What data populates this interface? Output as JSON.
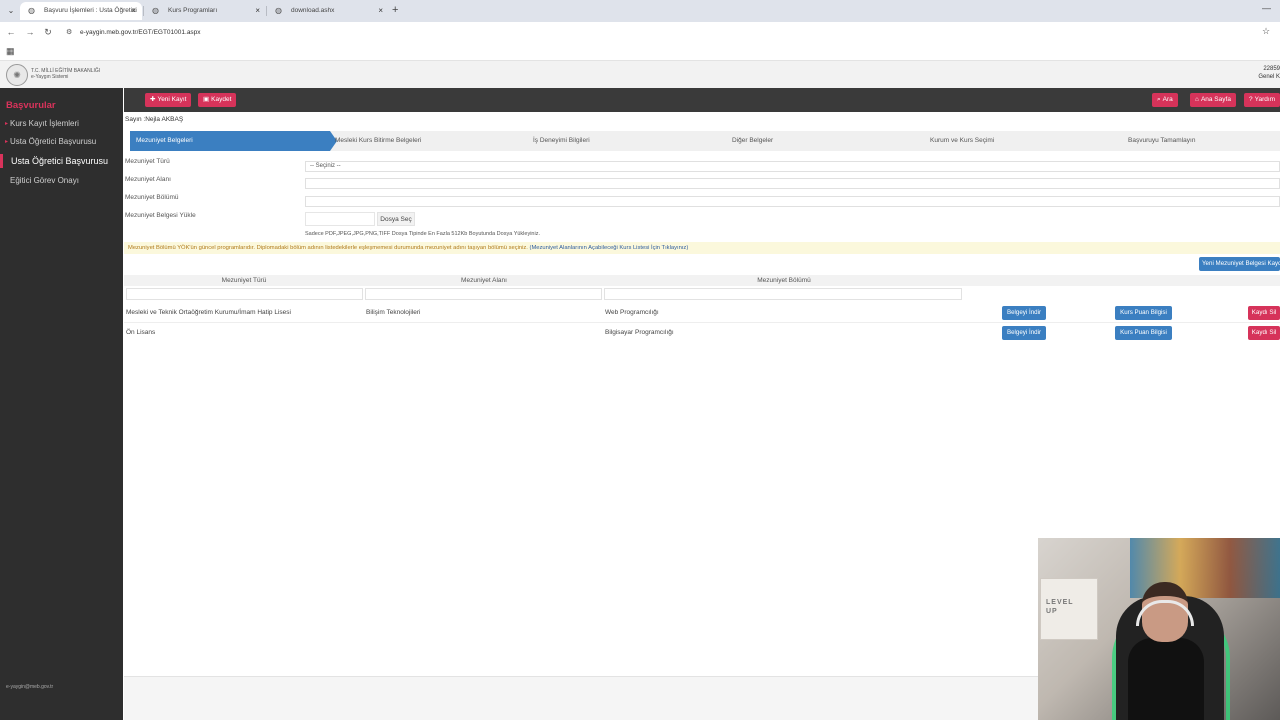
{
  "browser": {
    "tabs": [
      {
        "label": "Başvuru İşlemleri : Usta Öğretici",
        "icon": "globe-icon",
        "active": true
      },
      {
        "label": "Kurs Programları",
        "icon": "globe-icon",
        "active": false
      },
      {
        "label": "download.ashx",
        "icon": "globe-icon",
        "active": false
      }
    ],
    "tab_close": "×",
    "new_tab": "+",
    "url": "e-yaygin.meb.gov.tr/EGT/EGT01001.aspx"
  },
  "site": {
    "logo_line1": "T.C. MİLLİ EĞİTİM BAKANLIĞI",
    "logo_line2": "e-Yaygın Sistemi",
    "header_right_line1": "22859",
    "header_right_line2": "Genel K"
  },
  "sidebar": {
    "title": "Başvurular",
    "items": [
      {
        "label": "Kurs Kayıt İşlemleri",
        "bullet": true,
        "active": false
      },
      {
        "label": "Usta Öğretici Başvurusu",
        "bullet": true,
        "active": false
      },
      {
        "label": "Usta Öğretici Başvurusu",
        "bullet": false,
        "active": true
      },
      {
        "label": "Eğitici Görev Onayı",
        "bullet": false,
        "active": false
      }
    ],
    "footer_email": "e-yaygin@meb.gov.tr"
  },
  "toolbar": {
    "new_record": "Yeni Kayıt",
    "save": "Kaydet",
    "search": "Ara",
    "home": "Ana Sayfa",
    "help": "Yardım"
  },
  "user": {
    "greeting": "Sayın :Nejla AKBAŞ"
  },
  "steps": [
    "Mezuniyet Belgeleri",
    "Mesleki Kurs Bitirme Belgeleri",
    "İş Deneyimi Bilgileri",
    "Diğer Belgeler",
    "Kurum ve Kurs Seçimi",
    "Başvuruyu Tamamlayın"
  ],
  "form": {
    "type_label": "Mezuniyet Türü",
    "type_value": "-- Seçiniz --",
    "field_label": "Mezuniyet Alanı",
    "department_label": "Mezuniyet Bölümü",
    "upload_label": "Mezuniyet Belgesi Yükle",
    "file_button": "Dosya Seç",
    "file_hint": "Sadece PDF,JPEG,JPG,PNG,TIFF Dosya Tipinde En Fazla 512Kb Boyutunda Dosya Yükleyiniz."
  },
  "warning": {
    "text": "Mezuniyet Bölümü YÖK'ün güncel programlarıdır. Diplomadaki bölüm adının listedekilerle eşleşmemesi durumunda mezuniyet adını taşıyan bölümü seçiniz.",
    "link": "(Mezuniyet Alanlarının Açabileceği Kurs Listesi İçin Tıklayınız)"
  },
  "new_graduation_button": "Yeni Mezuniyet Belgesi Kaydet",
  "table": {
    "headers": [
      "Mezuniyet Türü",
      "Mezuniyet Alanı",
      "Mezuniyet Bölümü"
    ],
    "rows": [
      {
        "type": "Mesleki ve Teknik Ortaöğretim Kurumu/İmam Hatip Lisesi",
        "field": "Bilişim Teknolojileri",
        "department": "Web Programcılığı"
      },
      {
        "type": "Ön Lisans",
        "field": "",
        "department": "Bilgisayar Programcılığı"
      }
    ],
    "download_label": "Belgeyi İndir",
    "points_label": "Kurs Puan Bilgisi",
    "delete_label": "Kaydı Sil"
  },
  "colors": {
    "accent": "#d6335a",
    "primary": "#3b7fc1",
    "sidebar_bg": "#2e2e2e",
    "toolbar_bg": "#3a3a3a"
  }
}
